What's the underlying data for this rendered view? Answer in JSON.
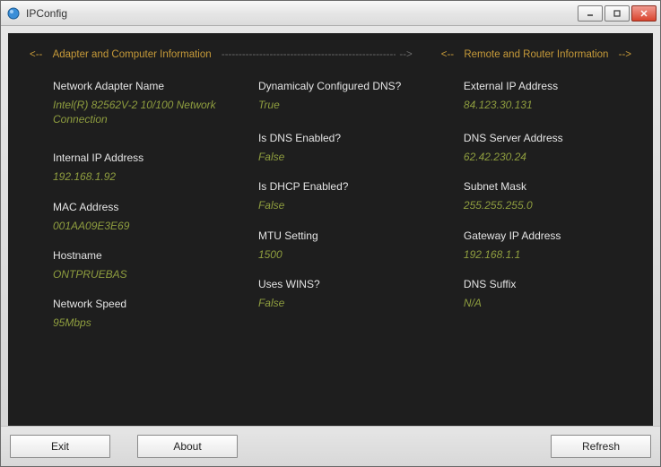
{
  "window": {
    "title": "IPConfig"
  },
  "headers": {
    "left_prefix": "<--",
    "left_label": "Adapter and Computer Information",
    "right_prefix": "<--",
    "right_label": "Remote and Router Information",
    "right_suffix": "-->",
    "arrow_suffix": "-->"
  },
  "col1": {
    "adapter_name_label": "Network Adapter Name",
    "adapter_name_value": "Intel(R) 82562V-2 10/100 Network Connection",
    "internal_ip_label": "Internal IP Address",
    "internal_ip_value": "192.168.1.92",
    "mac_label": "MAC Address",
    "mac_value": "001AA09E3E69",
    "hostname_label": "Hostname",
    "hostname_value": "ONTPRUEBAS",
    "speed_label": "Network Speed",
    "speed_value": "95Mbps"
  },
  "col2": {
    "dyn_dns_label": "Dynamicaly Configured DNS?",
    "dyn_dns_value": "True",
    "dns_enabled_label": "Is DNS Enabled?",
    "dns_enabled_value": "False",
    "dhcp_enabled_label": "Is DHCP Enabled?",
    "dhcp_enabled_value": "False",
    "mtu_label": "MTU Setting",
    "mtu_value": "1500",
    "wins_label": "Uses WINS?",
    "wins_value": "False"
  },
  "col3": {
    "external_ip_label": "External IP Address",
    "external_ip_value": "84.123.30.131",
    "dns_server_label": "DNS Server Address",
    "dns_server_value": "62.42.230.24",
    "subnet_label": "Subnet Mask",
    "subnet_value": "255.255.255.0",
    "gateway_label": "Gateway IP Address",
    "gateway_value": "192.168.1.1",
    "suffix_label": "DNS Suffix",
    "suffix_value": "N/A"
  },
  "buttons": {
    "exit": "Exit",
    "about": "About",
    "refresh": "Refresh"
  }
}
